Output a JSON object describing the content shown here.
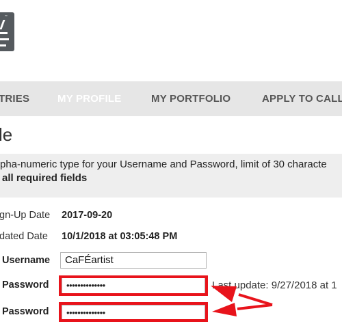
{
  "nav": {
    "items": [
      {
        "label": "TRIES",
        "active": false
      },
      {
        "label": "MY PROFILE",
        "active": true
      },
      {
        "label": "MY PORTFOLIO",
        "active": false
      },
      {
        "label": "APPLY TO CALL"
      }
    ]
  },
  "page": {
    "title": "le",
    "info_line": "pha-numeric type for your Username and Password, limit of 30 characte",
    "required_line": "all required fields"
  },
  "form": {
    "signup_label": "gn-Up Date",
    "signup_value": "2017-09-20",
    "updated_label": "dated Date",
    "updated_value": "10/1/2018 at 03:05:48 PM",
    "username_label": "Username",
    "username_value": "CaFÉartist",
    "password_label": "Password",
    "password_value": "••••••••••••••",
    "confirm_label": "Password",
    "confirm_value": "••••••••••••••",
    "last_update": "Last update: 9/27/2018 at 1"
  },
  "colors": {
    "nav_bg": "#e6e6e6",
    "info_bg": "#eeeeee",
    "highlight": "#e8131b",
    "logo": "#555a5e"
  }
}
